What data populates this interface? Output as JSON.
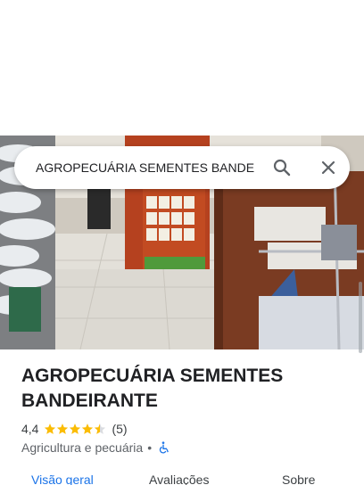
{
  "search": {
    "query": "AGROPECUÁRIA SEMENTES BANDE"
  },
  "place": {
    "title": "AGROPECUÁRIA SEMENTES BANDEIRANTE",
    "rating": "4,4",
    "rating_stars": 4.4,
    "review_count": "(5)",
    "category": "Agricultura e pecuária",
    "separator": "•"
  },
  "tabs": {
    "overview": "Visão geral",
    "reviews": "Avaliações",
    "about": "Sobre"
  },
  "colors": {
    "accent_blue": "#1a73e8",
    "star_gold": "#fbbc04",
    "text_primary": "#202124",
    "text_secondary": "#5f6368"
  },
  "icons": {
    "search": "search-icon",
    "close": "close-icon",
    "star": "star-icon",
    "wheelchair": "wheelchair-accessible-icon"
  }
}
